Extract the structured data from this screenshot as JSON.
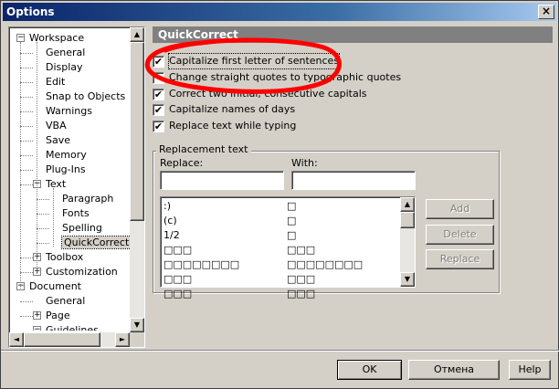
{
  "window": {
    "title": "Options",
    "close_glyph": "×"
  },
  "tree": {
    "items": [
      {
        "label": "Workspace",
        "level": 0,
        "expander": "−"
      },
      {
        "label": "General",
        "level": 1
      },
      {
        "label": "Display",
        "level": 1
      },
      {
        "label": "Edit",
        "level": 1
      },
      {
        "label": "Snap to Objects",
        "level": 1
      },
      {
        "label": "Warnings",
        "level": 1
      },
      {
        "label": "VBA",
        "level": 1
      },
      {
        "label": "Save",
        "level": 1
      },
      {
        "label": "Memory",
        "level": 1
      },
      {
        "label": "Plug-Ins",
        "level": 1
      },
      {
        "label": "Text",
        "level": 1,
        "expander": "−"
      },
      {
        "label": "Paragraph",
        "level": 2
      },
      {
        "label": "Fonts",
        "level": 2
      },
      {
        "label": "Spelling",
        "level": 2
      },
      {
        "label": "QuickCorrect",
        "level": 2,
        "selected": true
      },
      {
        "label": "Toolbox",
        "level": 1,
        "expander": "+"
      },
      {
        "label": "Customization",
        "level": 1,
        "expander": "+"
      },
      {
        "label": "Document",
        "level": 0,
        "expander": "−"
      },
      {
        "label": "General",
        "level": 1
      },
      {
        "label": "Page",
        "level": 1,
        "expander": "+"
      },
      {
        "label": "Guidelines",
        "level": 1,
        "expander": "−"
      }
    ]
  },
  "panel": {
    "header": "QuickCorrect",
    "checkboxes": [
      {
        "label": "Capitalize first letter of sentences",
        "checked": true
      },
      {
        "label": "Change straight quotes to typographic quotes",
        "checked": false
      },
      {
        "label": "Correct two initial, consecutive capitals",
        "checked": true
      },
      {
        "label": "Capitalize names of days",
        "checked": true
      },
      {
        "label": "Replace text while typing",
        "checked": true
      }
    ],
    "check_glyph": "✔"
  },
  "replacement": {
    "group_label": "Replacement text",
    "replace_label": "Replace:",
    "with_label": "With:",
    "replace_value": "",
    "with_value": "",
    "rows": [
      {
        "replace": ":)",
        "with": "□"
      },
      {
        "replace": "(c)",
        "with": "□"
      },
      {
        "replace": "1/2",
        "with": "□"
      },
      {
        "replace": "□□□",
        "with": "□□□"
      },
      {
        "replace": "□□□□□□□□",
        "with": "□□□□□□□□"
      },
      {
        "replace": "□□□",
        "with": "□□□"
      },
      {
        "replace": "□□□",
        "with": "□□□"
      }
    ],
    "buttons": {
      "add": "Add",
      "delete": "Delete",
      "replace": "Replace"
    }
  },
  "footer": {
    "ok": "OK",
    "cancel": "Отмена",
    "help": "Help"
  },
  "scroll_glyphs": {
    "up": "▲",
    "down": "▼",
    "left": "◄",
    "right": "►"
  },
  "colors": {
    "title_start": "#0a246a",
    "title_end": "#a6caf0",
    "annotation": "#ff0000",
    "face": "#d4d0c8"
  }
}
